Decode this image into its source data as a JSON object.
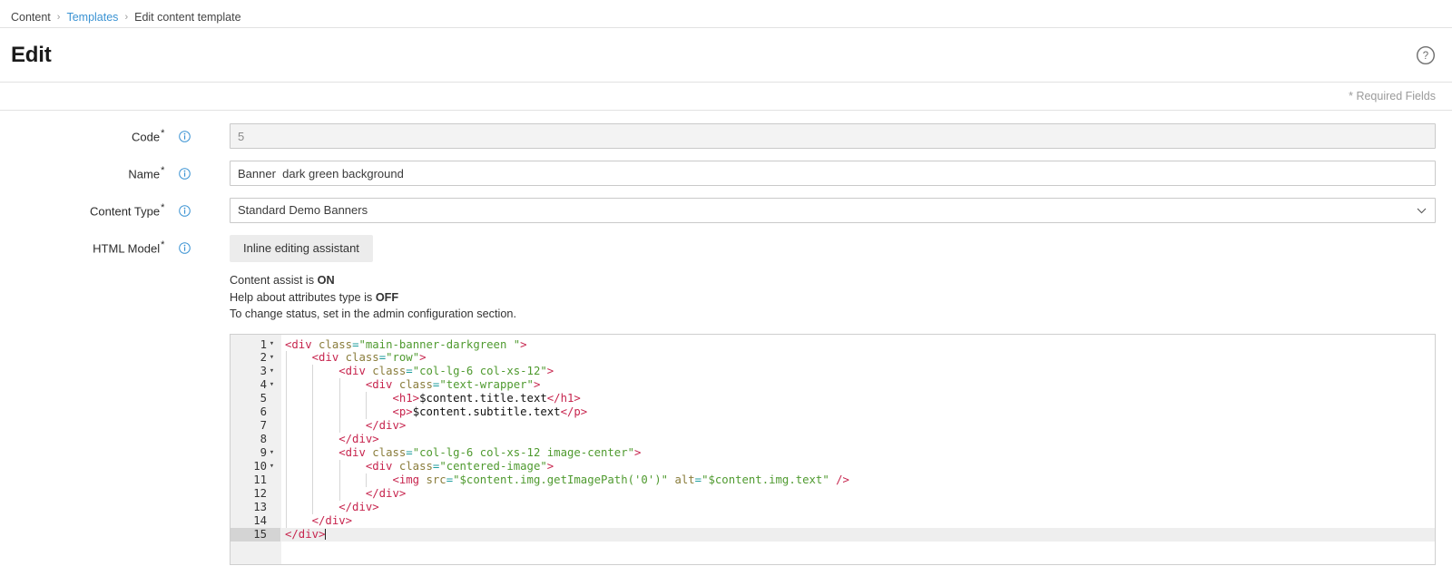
{
  "breadcrumb": {
    "items": [
      {
        "label": "Content",
        "link": false
      },
      {
        "label": "Templates",
        "link": true
      },
      {
        "label": "Edit content template",
        "link": false
      }
    ],
    "separator": "›"
  },
  "header": {
    "title": "Edit",
    "help_icon": "help-circle-icon",
    "required_note": "* Required Fields"
  },
  "form": {
    "required_marker": "*",
    "info_icon": "info-circle-icon",
    "fields": {
      "code": {
        "label": "Code",
        "value": "5",
        "readonly": true
      },
      "name": {
        "label": "Name",
        "value": "Banner  dark green background",
        "readonly": false
      },
      "content_type": {
        "label": "Content Type",
        "value": "Standard Demo Banners",
        "chevron_icon": "chevron-down-icon",
        "options": [
          "Standard Demo Banners"
        ]
      },
      "html_model": {
        "label": "HTML Model",
        "assistant_button": "Inline editing assistant",
        "status": [
          {
            "prefix": "Content assist is ",
            "state": "ON"
          },
          {
            "prefix": "Help about attributes type is ",
            "state": "OFF"
          },
          {
            "prefix": "To change status, set in the admin configuration section.",
            "state": ""
          }
        ]
      }
    }
  },
  "editor": {
    "active_line": 15,
    "fold_lines": [
      1,
      2,
      3,
      4,
      9,
      10
    ],
    "lines": [
      {
        "n": 1,
        "tokens": [
          {
            "t": "tag",
            "v": "<div "
          },
          {
            "t": "attr",
            "v": "class"
          },
          {
            "t": "eq",
            "v": "="
          },
          {
            "t": "str",
            "v": "\"main-banner-darkgreen \""
          },
          {
            "t": "tag",
            "v": ">"
          }
        ]
      },
      {
        "n": 2,
        "tokens": [
          {
            "t": "txt",
            "v": "    "
          },
          {
            "t": "tag",
            "v": "<div "
          },
          {
            "t": "attr",
            "v": "class"
          },
          {
            "t": "eq",
            "v": "="
          },
          {
            "t": "str",
            "v": "\"row\""
          },
          {
            "t": "tag",
            "v": ">"
          }
        ]
      },
      {
        "n": 3,
        "tokens": [
          {
            "t": "txt",
            "v": "        "
          },
          {
            "t": "tag",
            "v": "<div "
          },
          {
            "t": "attr",
            "v": "class"
          },
          {
            "t": "eq",
            "v": "="
          },
          {
            "t": "str",
            "v": "\"col-lg-6 col-xs-12\""
          },
          {
            "t": "tag",
            "v": ">"
          }
        ]
      },
      {
        "n": 4,
        "tokens": [
          {
            "t": "txt",
            "v": "            "
          },
          {
            "t": "tag",
            "v": "<div "
          },
          {
            "t": "attr",
            "v": "class"
          },
          {
            "t": "eq",
            "v": "="
          },
          {
            "t": "str",
            "v": "\"text-wrapper\""
          },
          {
            "t": "tag",
            "v": ">"
          }
        ]
      },
      {
        "n": 5,
        "tokens": [
          {
            "t": "txt",
            "v": "                "
          },
          {
            "t": "tag",
            "v": "<h1>"
          },
          {
            "t": "txt",
            "v": "$content.title.text"
          },
          {
            "t": "tag",
            "v": "</h1>"
          }
        ]
      },
      {
        "n": 6,
        "tokens": [
          {
            "t": "txt",
            "v": "                "
          },
          {
            "t": "tag",
            "v": "<p>"
          },
          {
            "t": "txt",
            "v": "$content.subtitle.text"
          },
          {
            "t": "tag",
            "v": "</p>"
          }
        ]
      },
      {
        "n": 7,
        "tokens": [
          {
            "t": "txt",
            "v": "            "
          },
          {
            "t": "tag",
            "v": "</div>"
          }
        ]
      },
      {
        "n": 8,
        "tokens": [
          {
            "t": "txt",
            "v": "        "
          },
          {
            "t": "tag",
            "v": "</div>"
          }
        ]
      },
      {
        "n": 9,
        "tokens": [
          {
            "t": "txt",
            "v": "        "
          },
          {
            "t": "tag",
            "v": "<div "
          },
          {
            "t": "attr",
            "v": "class"
          },
          {
            "t": "eq",
            "v": "="
          },
          {
            "t": "str",
            "v": "\"col-lg-6 col-xs-12 image-center\""
          },
          {
            "t": "tag",
            "v": ">"
          }
        ]
      },
      {
        "n": 10,
        "tokens": [
          {
            "t": "txt",
            "v": "            "
          },
          {
            "t": "tag",
            "v": "<div "
          },
          {
            "t": "attr",
            "v": "class"
          },
          {
            "t": "eq",
            "v": "="
          },
          {
            "t": "str",
            "v": "\"centered-image\""
          },
          {
            "t": "tag",
            "v": ">"
          }
        ]
      },
      {
        "n": 11,
        "tokens": [
          {
            "t": "txt",
            "v": "                "
          },
          {
            "t": "tag",
            "v": "<img "
          },
          {
            "t": "attr",
            "v": "src"
          },
          {
            "t": "eq",
            "v": "="
          },
          {
            "t": "str",
            "v": "\"$content.img.getImagePath('0')\""
          },
          {
            "t": "txt",
            "v": " "
          },
          {
            "t": "attr",
            "v": "alt"
          },
          {
            "t": "eq",
            "v": "="
          },
          {
            "t": "str",
            "v": "\"$content.img.text\""
          },
          {
            "t": "tag",
            "v": " />"
          }
        ]
      },
      {
        "n": 12,
        "tokens": [
          {
            "t": "txt",
            "v": "            "
          },
          {
            "t": "tag",
            "v": "</div>"
          }
        ]
      },
      {
        "n": 13,
        "tokens": [
          {
            "t": "txt",
            "v": "        "
          },
          {
            "t": "tag",
            "v": "</div>"
          }
        ]
      },
      {
        "n": 14,
        "tokens": [
          {
            "t": "txt",
            "v": "    "
          },
          {
            "t": "tag",
            "v": "</div>"
          }
        ]
      },
      {
        "n": 15,
        "tokens": [
          {
            "t": "tag",
            "v": "</div>"
          }
        ]
      }
    ]
  },
  "colors": {
    "link": "#3b93d3",
    "info_icon": "#3b93d3",
    "tag": "#c7254e",
    "attribute": "#8a7d3c",
    "equals": "#1d9e9e",
    "string": "#4f9a2f",
    "gutter_bg": "#f0f0f0",
    "active_line_bg": "#eeeeee"
  }
}
